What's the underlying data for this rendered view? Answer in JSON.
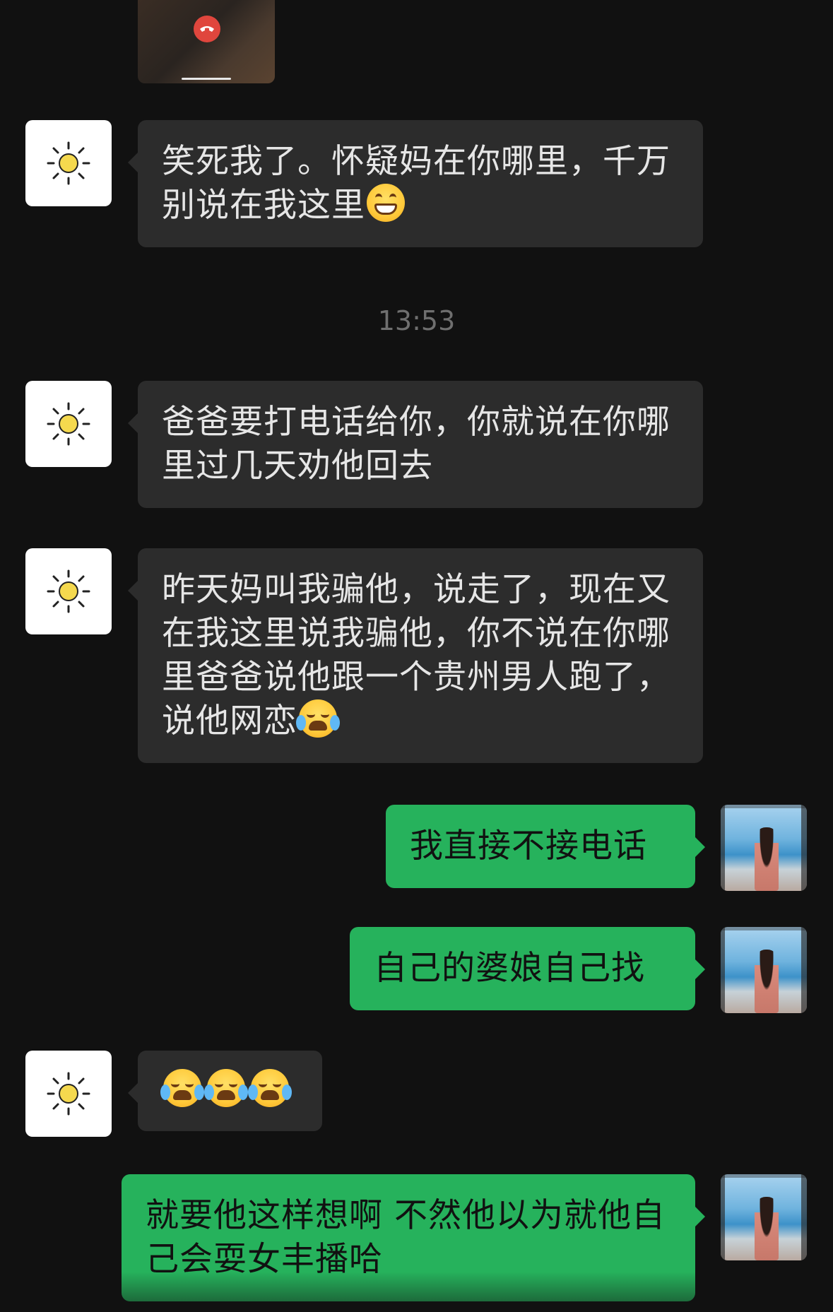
{
  "timestamp": "13:53",
  "messages": [
    {
      "side": "left",
      "avatar": "sun-icon",
      "text_before": "笑死我了。怀疑妈在你哪里，千万别说在我这里",
      "emoji": [
        "grinning-emoji"
      ]
    },
    {
      "side": "left",
      "avatar": "sun-icon",
      "text_before": "爸爸要打电话给你，你就说在你哪里过几天劝他回去",
      "emoji": []
    },
    {
      "side": "left",
      "avatar": "sun-icon",
      "text_before": "昨天妈叫我骗他，说走了，现在又在我这里说我骗他，你不说在你哪里爸爸说他跟一个贵州男人跑了，说他网恋",
      "emoji": [
        "crying-laughing-emoji"
      ]
    },
    {
      "side": "right",
      "avatar": "user-photo",
      "text_before": "我直接不接电话",
      "emoji": []
    },
    {
      "side": "right",
      "avatar": "user-photo",
      "text_before": "自己的婆娘自己找",
      "emoji": []
    },
    {
      "side": "left",
      "avatar": "sun-icon",
      "text_before": "",
      "emoji": [
        "crying-laughing-emoji",
        "crying-laughing-emoji",
        "crying-laughing-emoji"
      ]
    },
    {
      "side": "right",
      "avatar": "user-photo",
      "text_before": "就要他这样想啊 不然他以为就他自己会耍女丰播哈",
      "emoji": []
    }
  ],
  "colors": {
    "background": "#111111",
    "incoming_bubble": "#2c2c2c",
    "outgoing_bubble": "#26b25c",
    "hangup": "#e0463d"
  }
}
